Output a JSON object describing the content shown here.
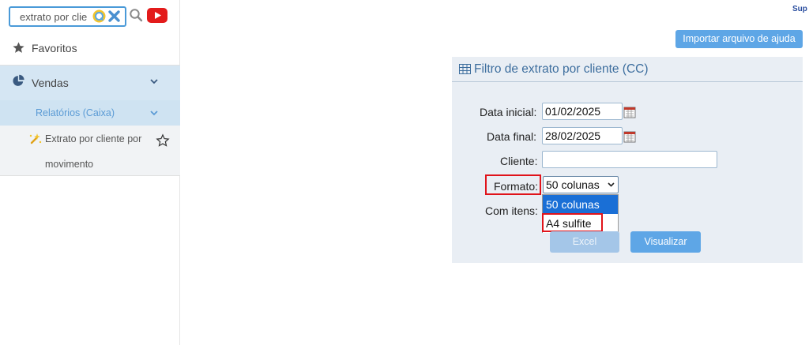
{
  "sidebar": {
    "search": {
      "value": "extrato por clie"
    },
    "favoritos_label": "Favoritos",
    "vendas_label": "Vendas",
    "relatorios_label": "Relatórios (Caixa)",
    "item_line1": "Extrato por cliente por",
    "item_line2": "movimento"
  },
  "header": {
    "sup_label": "Sup",
    "import_button": "Importar arquivo de ajuda"
  },
  "panel": {
    "title": "Filtro de extrato por cliente (CC)",
    "data_inicial_label": "Data inicial:",
    "data_inicial_value": "01/02/2025",
    "data_final_label": "Data final:",
    "data_final_value": "28/02/2025",
    "cliente_label": "Cliente:",
    "cliente_value": "",
    "formato_label": "Formato:",
    "formato_selected": "50 colunas",
    "formato_options": [
      "50 colunas",
      "A4 sulfite"
    ],
    "com_itens_label": "Com itens:",
    "excel_button": "Excel",
    "visualizar_button": "Visualizar"
  },
  "colors": {
    "accent": "#5ea6e6",
    "sidebar_active": "#d5e6f3",
    "highlight": "#e0131a",
    "dropdown_selected": "#1a6fd6"
  }
}
